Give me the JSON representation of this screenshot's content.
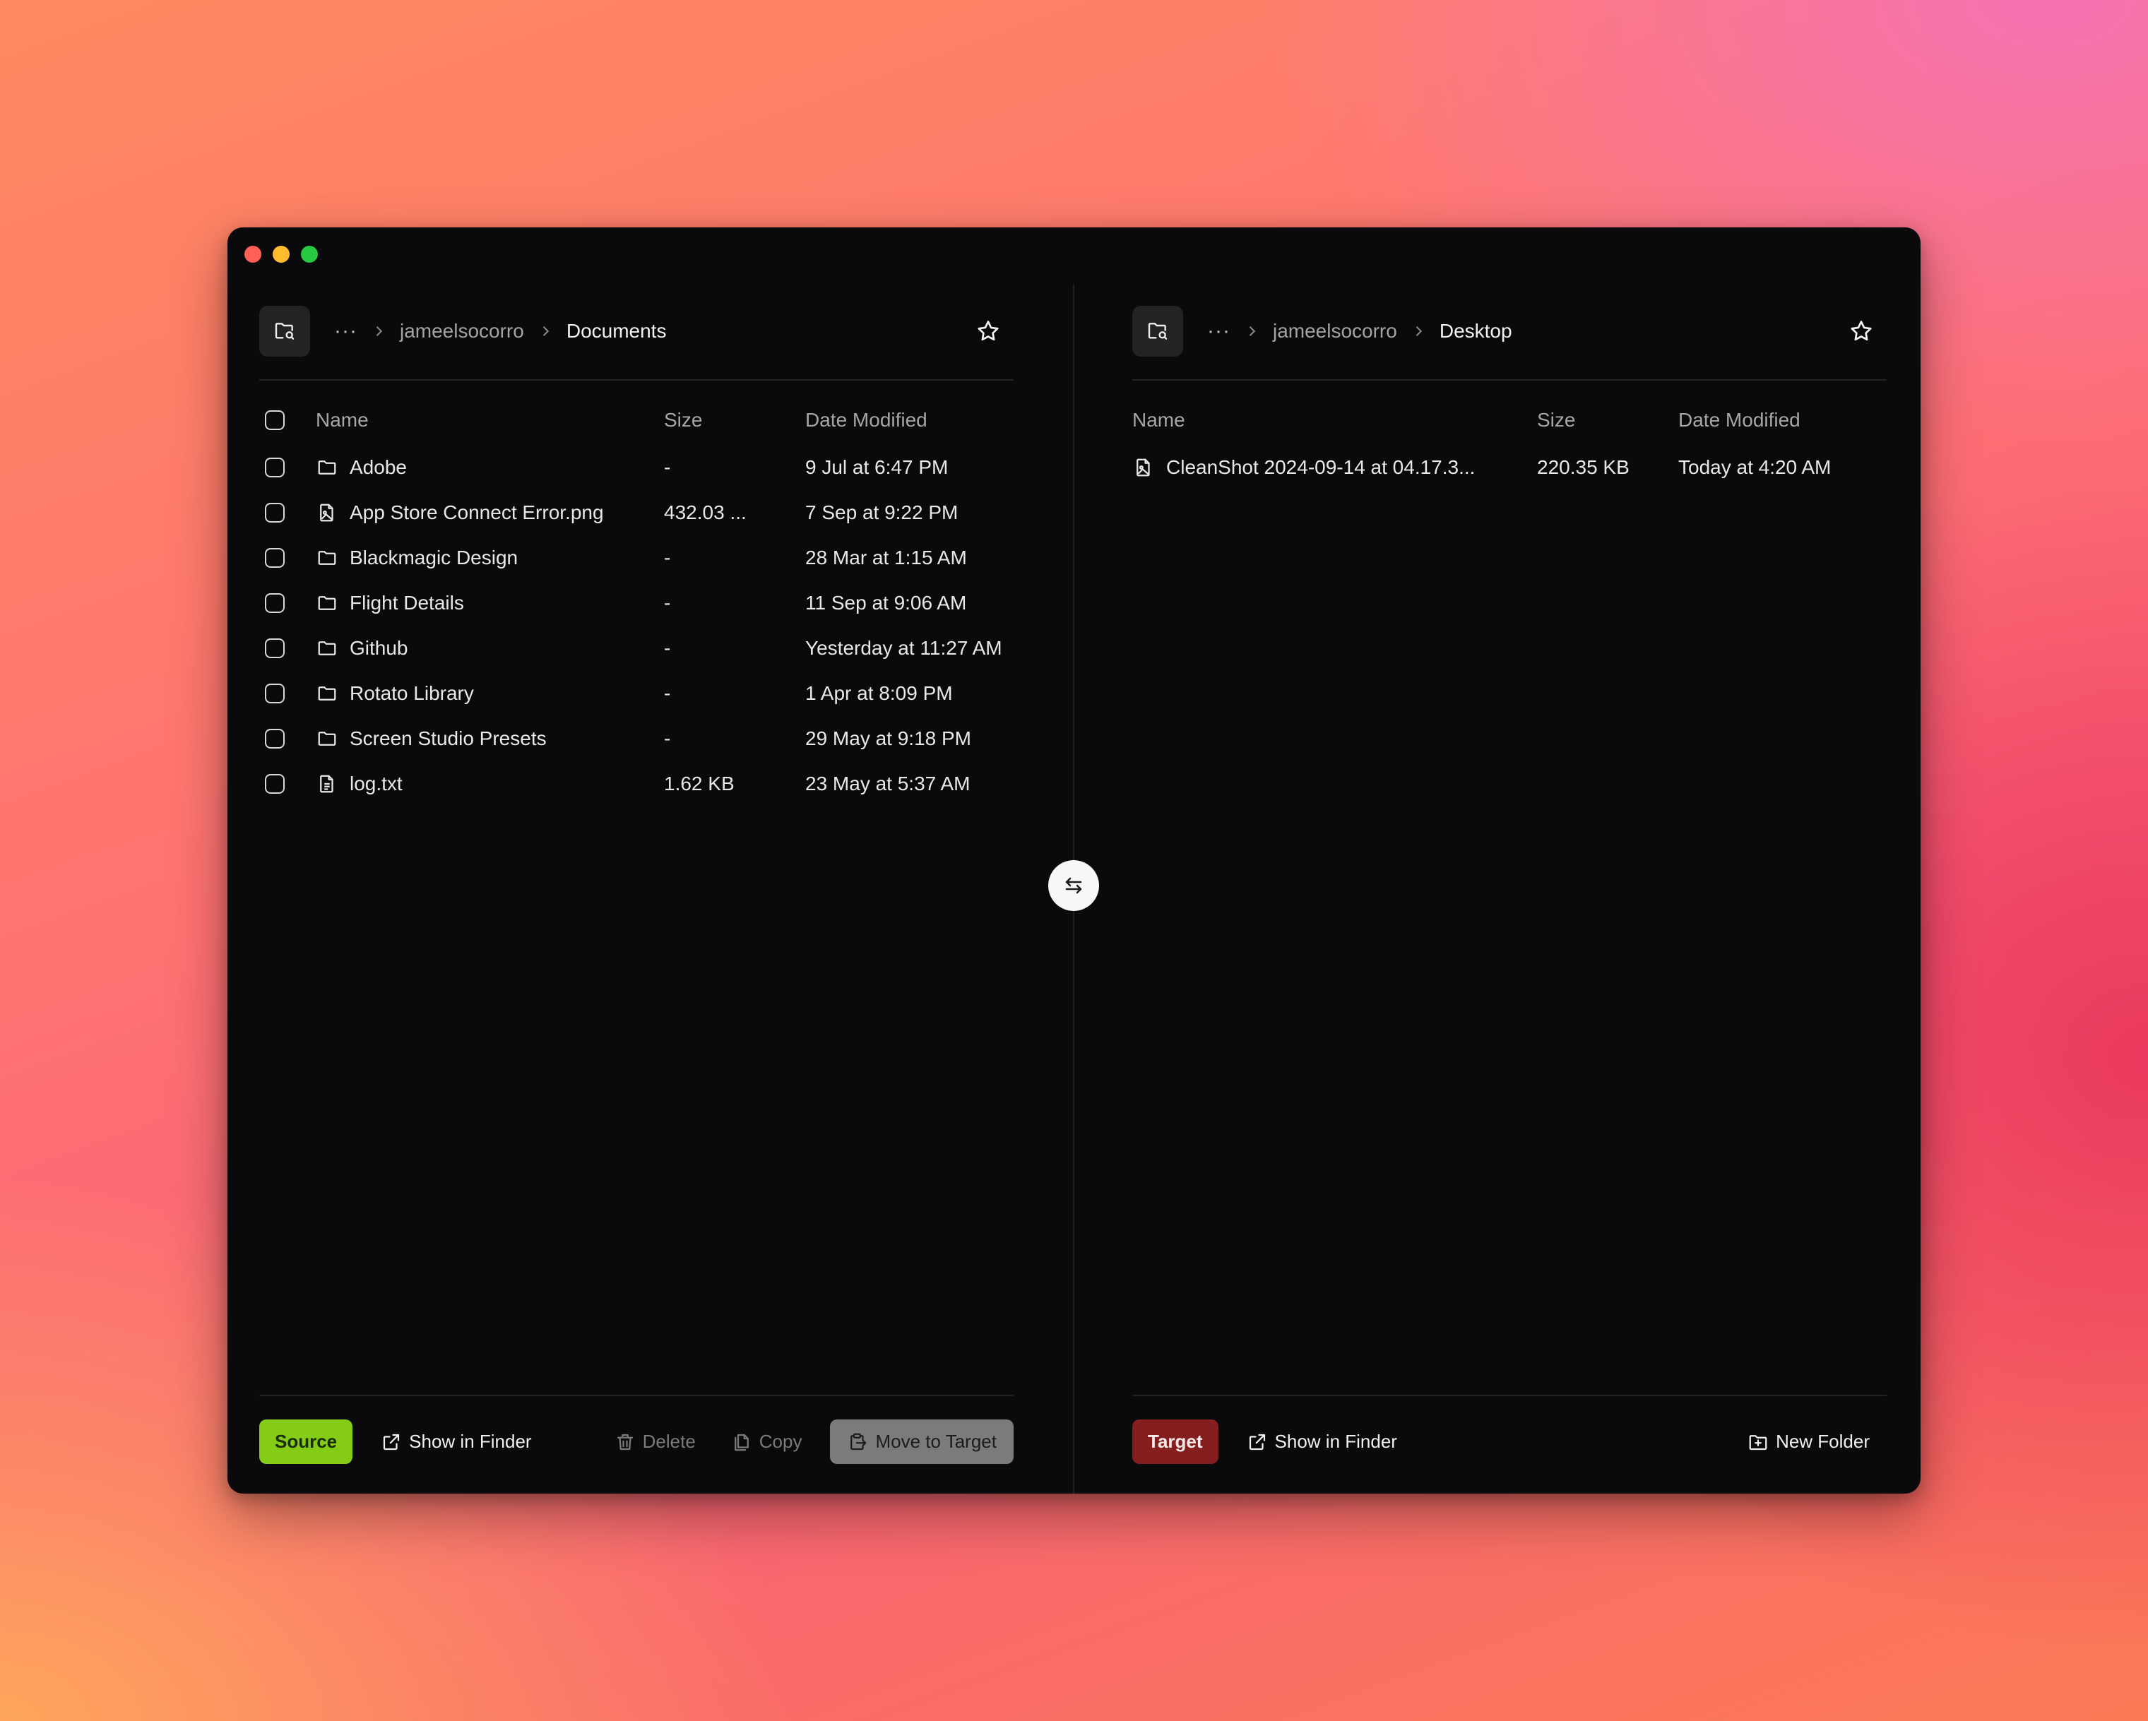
{
  "colors": {
    "source": "#84cc16",
    "target": "#851f1f",
    "window_bg": "#0a0a0c"
  },
  "left": {
    "breadcrumb": {
      "more": "···",
      "parent": "jameelsocorro",
      "current": "Documents"
    },
    "columns": {
      "name": "Name",
      "size": "Size",
      "date": "Date Modified"
    },
    "files": [
      {
        "name": "Adobe",
        "type": "folder",
        "size": "-",
        "date": "9 Jul at 6:47 PM"
      },
      {
        "name": "App Store Connect Error.png",
        "type": "image",
        "size": "432.03 ...",
        "date": "7 Sep at 9:22 PM"
      },
      {
        "name": "Blackmagic Design",
        "type": "folder",
        "size": "-",
        "date": "28 Mar at 1:15 AM"
      },
      {
        "name": "Flight Details",
        "type": "folder",
        "size": "-",
        "date": "11 Sep at 9:06 AM"
      },
      {
        "name": "Github",
        "type": "folder",
        "size": "-",
        "date": "Yesterday at 11:27 AM"
      },
      {
        "name": "Rotato Library",
        "type": "folder",
        "size": "-",
        "date": "1 Apr at 8:09 PM"
      },
      {
        "name": "Screen Studio Presets",
        "type": "folder",
        "size": "-",
        "date": "29 May at 9:18 PM"
      },
      {
        "name": "log.txt",
        "type": "text",
        "size": "1.62 KB",
        "date": "23 May at 5:37 AM"
      }
    ],
    "footer": {
      "tag": "Source",
      "show_in_finder": "Show in Finder",
      "delete": "Delete",
      "copy": "Copy",
      "move": "Move to Target"
    }
  },
  "right": {
    "breadcrumb": {
      "more": "···",
      "parent": "jameelsocorro",
      "current": "Desktop"
    },
    "columns": {
      "name": "Name",
      "size": "Size",
      "date": "Date Modified"
    },
    "files": [
      {
        "name": "CleanShot 2024-09-14 at 04.17.3...",
        "type": "image",
        "size": "220.35 KB",
        "date": "Today at 4:20 AM"
      }
    ],
    "footer": {
      "tag": "Target",
      "show_in_finder": "Show in Finder",
      "new_folder": "New Folder"
    }
  },
  "icons": {
    "folder_search": "folder-search-icon",
    "star": "star-icon",
    "swap": "swap-arrows-icon",
    "folder": "folder-icon",
    "image_file": "image-file-icon",
    "text_file": "text-file-icon",
    "external_link": "external-link-icon",
    "trash": "trash-icon",
    "copy": "copy-icon",
    "clipboard_move": "clipboard-move-icon",
    "folder_plus": "folder-plus-icon"
  }
}
